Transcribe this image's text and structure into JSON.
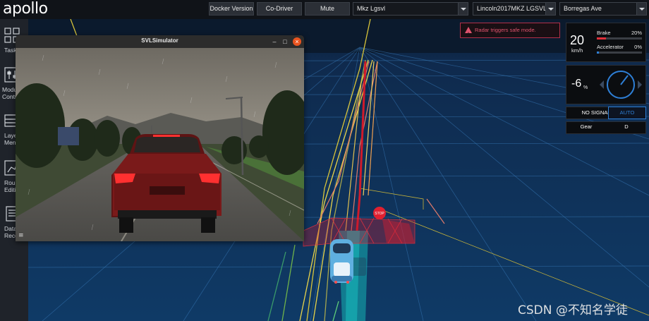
{
  "header": {
    "logo": "apollo",
    "docker_version_label": "Docker Version",
    "co_driver_label": "Co-Driver",
    "mute_label": "Mute",
    "mode_select": "Mkz Lgsvl",
    "vehicle_select": "Lincoln2017MKZ LGSVL",
    "map_select": "Borregas Ave"
  },
  "sidebar": {
    "items": [
      {
        "label": "Task",
        "icon": "grid-icon"
      },
      {
        "label": "Modu\nContr",
        "icon": "module-control-icon"
      },
      {
        "label": "Laye\nMen",
        "icon": "layer-menu-icon"
      },
      {
        "label": "Rou\nEditi",
        "icon": "route-editing-icon"
      },
      {
        "label": "Data\nReco",
        "icon": "data-recorder-icon"
      }
    ]
  },
  "simulator": {
    "title": "SVLSimulator",
    "minimize": "–",
    "maximize": "□",
    "close": "×",
    "menu": "≡"
  },
  "alert": {
    "text": "Radar triggers safe mode."
  },
  "dashboard": {
    "speed": "20",
    "speed_unit": "km/h",
    "brake_label": "Brake",
    "brake_value": "20%",
    "brake_level": 0.2,
    "accel_label": "Accelerator",
    "accel_value": "0%",
    "accel_level": 0.0,
    "steering_value": "-6",
    "steering_unit": "%",
    "signal_label": "NO SIGNAL",
    "drive_mode": "AUTO",
    "gear_label": "Gear",
    "gear_value": "D"
  },
  "scene": {
    "stop_sign": "STOP"
  },
  "colors": {
    "accent": "#2e7fd6",
    "alert": "#e0536e",
    "brake": "#e0303a",
    "accel": "#2e7fd6",
    "grid": "#2f6aa6",
    "ground": "#10355e"
  },
  "watermark": "CSDN @不知名学徒"
}
